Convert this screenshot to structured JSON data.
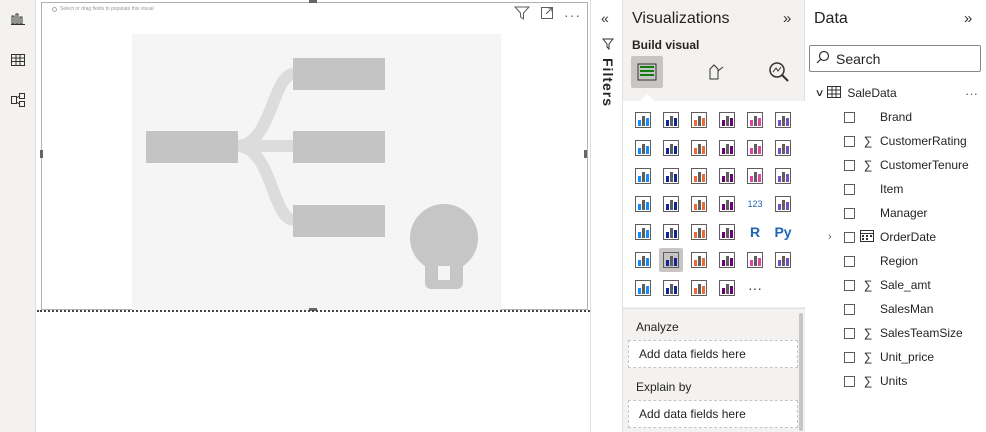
{
  "canvas": {
    "placeholder_hint": "Select or drag fields to populate this visual"
  },
  "filters": {
    "label": "Filters"
  },
  "visualizations": {
    "title": "Visualizations",
    "build_label": "Build visual",
    "icons": [
      "stacked-bar-chart-icon",
      "stacked-column-chart-icon",
      "clustered-bar-chart-icon",
      "clustered-column-chart-icon",
      "100-stacked-bar-chart-icon",
      "100-stacked-column-chart-icon",
      "line-chart-icon",
      "area-chart-icon",
      "stacked-area-chart-icon",
      "line-and-stacked-column-icon",
      "line-and-clustered-column-icon",
      "ribbon-chart-icon",
      "waterfall-chart-icon",
      "funnel-chart-icon",
      "scatter-chart-icon",
      "pie-chart-icon",
      "donut-chart-icon",
      "treemap-icon",
      "map-icon",
      "filled-map-icon",
      "azure-map-icon",
      "gauge-icon",
      "card-icon",
      "multi-row-card-icon",
      "kpi-icon",
      "slicer-icon",
      "table-icon",
      "matrix-icon",
      "r-script-visual-icon",
      "python-visual-icon",
      "key-influencers-icon",
      "decomposition-tree-icon",
      "qa-icon",
      "smart-narrative-icon",
      "metrics-icon",
      "paginated-report-icon",
      "power-apps-icon",
      "power-automate-icon",
      "power-apps-diamond-icon",
      "power-automate-chevron-icon",
      "more-visuals-icon"
    ],
    "wells": [
      {
        "label": "Analyze",
        "placeholder": "Add data fields here"
      },
      {
        "label": "Explain by",
        "placeholder": "Add data fields here"
      }
    ]
  },
  "data": {
    "title": "Data",
    "search_placeholder": "Search",
    "table_name": "SaleData",
    "fields": [
      {
        "name": "Brand",
        "sigma": false,
        "date": false
      },
      {
        "name": "CustomerRating",
        "sigma": true,
        "date": false
      },
      {
        "name": "CustomerTenure",
        "sigma": true,
        "date": false
      },
      {
        "name": "Item",
        "sigma": false,
        "date": false
      },
      {
        "name": "Manager",
        "sigma": false,
        "date": false
      },
      {
        "name": "OrderDate",
        "sigma": false,
        "date": true
      },
      {
        "name": "Region",
        "sigma": false,
        "date": false
      },
      {
        "name": "Sale_amt",
        "sigma": true,
        "date": false
      },
      {
        "name": "SalesMan",
        "sigma": false,
        "date": false
      },
      {
        "name": "SalesTeamSize",
        "sigma": true,
        "date": false
      },
      {
        "name": "Unit_price",
        "sigma": true,
        "date": false
      },
      {
        "name": "Units",
        "sigma": true,
        "date": false
      }
    ]
  }
}
